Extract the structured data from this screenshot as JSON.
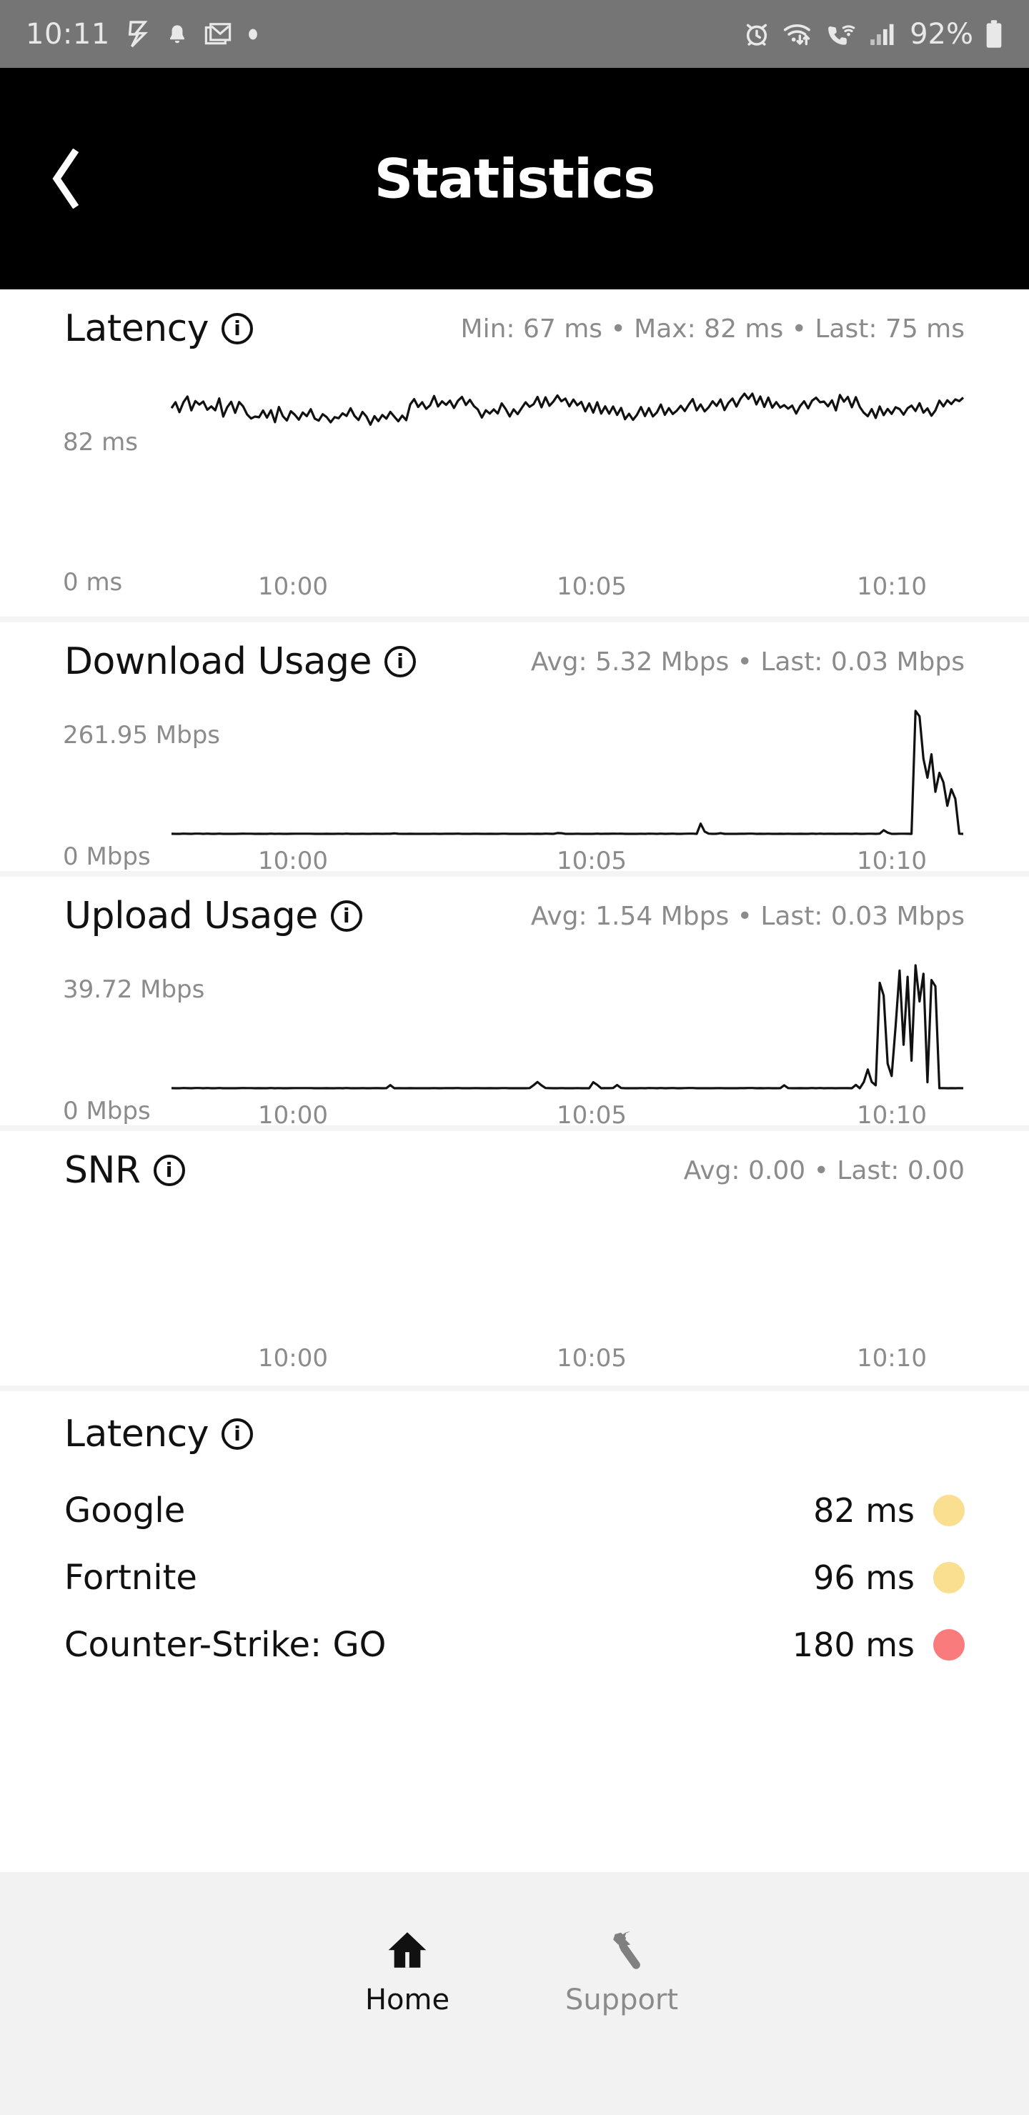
{
  "status_bar": {
    "time": "10:11",
    "battery_percent": "92%",
    "left_icons": [
      "nfc-icon",
      "bell-icon",
      "gmail-icon",
      "dot-icon"
    ],
    "right_icons": [
      "alarm-icon",
      "wifi-transfer-icon",
      "wifi-calling-icon",
      "signal-bars-icon",
      "battery-icon"
    ],
    "bg_color": "#757575",
    "fg_color": "#e8e8e8"
  },
  "header": {
    "title": "Statistics",
    "back_icon": "chevron-left-icon",
    "bg_color": "#000000",
    "fg_color": "#ffffff"
  },
  "sections": [
    {
      "key": "latency",
      "title": "Latency",
      "info_icon": "info-icon",
      "stats": "Min: 67 ms • Max: 82 ms • Last: 75 ms",
      "y_top": "82 ms",
      "y_bottom": "0 ms",
      "x_labels": [
        "10:00",
        "10:05",
        "10:10"
      ]
    },
    {
      "key": "download",
      "title": "Download Usage",
      "info_icon": "info-icon",
      "stats": "Avg: 5.32 Mbps • Last: 0.03 Mbps",
      "y_top": "261.95 Mbps",
      "y_bottom": "0 Mbps",
      "x_labels": [
        "10:00",
        "10:05",
        "10:10"
      ]
    },
    {
      "key": "upload",
      "title": "Upload Usage",
      "info_icon": "info-icon",
      "stats": "Avg: 1.54 Mbps • Last: 0.03 Mbps",
      "y_top": "39.72 Mbps",
      "y_bottom": "0 Mbps",
      "x_labels": [
        "10:00",
        "10:05",
        "10:10"
      ]
    },
    {
      "key": "snr",
      "title": "SNR",
      "info_icon": "info-icon",
      "stats": "Avg: 0.00 • Last: 0.00",
      "y_top": "",
      "y_bottom": "",
      "x_labels": [
        "10:00",
        "10:05",
        "10:10"
      ]
    }
  ],
  "latency_list": {
    "title": "Latency",
    "info_icon": "info-icon",
    "rows": [
      {
        "name": "Google",
        "value": "82 ms",
        "dot_color": "#fadf91"
      },
      {
        "name": "Fortnite",
        "value": "96 ms",
        "dot_color": "#fadf91"
      },
      {
        "name": "Counter-Strike: GO",
        "value": "180 ms",
        "dot_color": "#f97b7b"
      }
    ]
  },
  "bottom_nav": {
    "bg_color": "#f2f2f2",
    "items": [
      {
        "label": "Home",
        "icon": "home-icon",
        "active": true,
        "color": "#111111"
      },
      {
        "label": "Support",
        "icon": "wrench-icon",
        "active": false,
        "color": "#8b8b8b"
      }
    ]
  },
  "chart_data": [
    {
      "type": "line",
      "title": "Latency",
      "ylabel": "ms",
      "ylim": [
        0,
        82
      ],
      "yticks": [
        "0 ms",
        "82 ms"
      ],
      "x": [
        "10:00",
        "10:05",
        "10:10"
      ],
      "xlabel": "",
      "grid": false,
      "legend": "none",
      "stats": {
        "min": 67,
        "max": 82,
        "last": 75,
        "unit": "ms"
      },
      "values": [
        74,
        78,
        72,
        76,
        80,
        73,
        77,
        75,
        79,
        72,
        76,
        74,
        78,
        71,
        75,
        79,
        73,
        77,
        74,
        70,
        68,
        71,
        69,
        73,
        70,
        72,
        68,
        74,
        71,
        69,
        72,
        70,
        67,
        71,
        69,
        73,
        70,
        68,
        72,
        69,
        67,
        70,
        68,
        72,
        69,
        74,
        71,
        68,
        72,
        70,
        66,
        69,
        67,
        71,
        68,
        72,
        70,
        67,
        71,
        69,
        76,
        79,
        75,
        78,
        74,
        77,
        80,
        76,
        79,
        75,
        78,
        74,
        77,
        81,
        76,
        79,
        75,
        73,
        70,
        74,
        71,
        75,
        72,
        76,
        73,
        70,
        74,
        71,
        75,
        78,
        74,
        77,
        80,
        76,
        79,
        75,
        78,
        82,
        77,
        80,
        76,
        79,
        75,
        78,
        74,
        77,
        73,
        76,
        72,
        75,
        71,
        74,
        70,
        73,
        69,
        72,
        68,
        71,
        74,
        70,
        73,
        69,
        72,
        75,
        71,
        74,
        70,
        73,
        76,
        72,
        75,
        78,
        74,
        77,
        73,
        76,
        79,
        75,
        78,
        74,
        77,
        80,
        76,
        79,
        82,
        78,
        81,
        77,
        80,
        76,
        79,
        75,
        78,
        74,
        77,
        73,
        76,
        72,
        75,
        78,
        74,
        77,
        80,
        76,
        79,
        75,
        78,
        74,
        81,
        77,
        80,
        76,
        79,
        75,
        72,
        69,
        73,
        70,
        74,
        71,
        75,
        72,
        76,
        73,
        70,
        74,
        77,
        73,
        76,
        72,
        75,
        71,
        74,
        78,
        75,
        79,
        76,
        80,
        77,
        81
      ]
    },
    {
      "type": "line",
      "title": "Download Usage",
      "ylabel": "Mbps",
      "ylim": [
        0,
        261.95
      ],
      "yticks": [
        "0 Mbps",
        "261.95 Mbps"
      ],
      "x": [
        "10:00",
        "10:05",
        "10:10"
      ],
      "xlabel": "",
      "grid": false,
      "legend": "none",
      "stats": {
        "avg": 5.32,
        "last": 0.03,
        "unit": "Mbps"
      },
      "values": [
        0,
        0,
        0,
        0,
        0,
        0,
        0,
        0,
        0,
        0,
        0,
        0,
        0,
        0,
        0,
        0,
        0,
        0,
        0,
        0,
        0,
        0,
        0,
        0,
        0,
        0,
        0,
        0,
        0,
        0,
        0,
        0,
        0,
        0,
        0,
        0,
        0,
        0,
        0,
        0,
        0,
        0,
        0,
        0,
        0,
        0,
        0,
        0,
        0,
        0,
        0,
        0,
        0,
        0,
        0,
        0,
        1,
        0,
        0,
        0,
        0,
        0,
        0,
        0,
        0,
        0,
        0,
        0,
        0,
        0,
        0,
        0,
        0,
        0,
        0,
        0,
        0,
        0,
        0,
        0,
        0,
        0,
        0,
        0,
        0,
        0,
        0,
        0,
        0,
        0,
        0,
        0,
        0,
        0,
        0,
        0,
        0,
        2,
        1,
        0,
        0,
        0,
        0,
        0,
        0,
        0,
        0,
        0,
        0,
        0,
        0,
        0,
        0,
        0,
        0,
        0,
        0,
        0,
        0,
        0,
        0,
        0,
        0,
        0,
        0,
        0,
        0,
        0,
        0,
        0,
        0,
        0,
        0,
        22,
        5,
        1,
        0,
        0,
        1,
        0,
        0,
        0,
        0,
        0,
        0,
        0,
        0,
        0,
        0,
        0,
        0,
        0,
        0,
        0,
        0,
        0,
        0,
        0,
        0,
        0,
        0,
        0,
        0,
        0,
        0,
        0,
        0,
        0,
        0,
        0,
        0,
        0,
        0,
        0,
        0,
        0,
        0,
        0,
        0,
        8,
        3,
        0,
        0,
        0,
        0,
        0,
        0,
        262,
        250,
        160,
        120,
        170,
        90,
        130,
        110,
        60,
        95,
        75,
        0,
        0
      ]
    },
    {
      "type": "line",
      "title": "Upload Usage",
      "ylabel": "Mbps",
      "ylim": [
        0,
        39.72
      ],
      "yticks": [
        "0 Mbps",
        "39.72 Mbps"
      ],
      "x": [
        "10:00",
        "10:05",
        "10:10"
      ],
      "xlabel": "",
      "grid": false,
      "legend": "none",
      "stats": {
        "avg": 1.54,
        "last": 0.03,
        "unit": "Mbps"
      },
      "values": [
        0,
        0,
        0,
        0,
        0,
        0,
        0,
        0,
        0,
        0,
        0,
        0,
        0,
        0,
        0,
        0,
        0,
        0,
        0,
        0,
        0,
        0,
        0,
        0,
        0,
        0,
        0,
        0,
        0,
        0,
        0,
        0,
        0,
        0,
        0,
        0,
        0,
        0,
        0,
        0,
        0,
        0,
        0,
        0,
        0,
        0,
        0,
        0,
        0,
        0,
        0,
        0,
        0,
        0,
        0,
        1,
        0,
        0,
        0,
        0,
        0,
        0,
        0,
        0,
        0,
        0,
        0,
        0,
        0,
        0,
        0,
        0,
        0,
        0,
        0,
        0,
        0,
        0,
        0,
        0,
        0,
        0,
        0,
        0,
        0,
        0,
        0,
        0,
        0,
        0,
        0,
        1,
        2,
        1,
        0,
        0,
        0,
        0,
        0,
        0,
        0,
        0,
        0,
        0,
        0,
        0,
        2,
        1,
        0,
        0,
        0,
        0,
        1,
        0,
        0,
        0,
        0,
        0,
        0,
        0,
        0,
        0,
        0,
        0,
        0,
        0,
        0,
        0,
        0,
        0,
        0,
        0,
        0,
        0,
        0,
        0,
        0,
        0,
        0,
        0,
        0,
        0,
        0,
        0,
        0,
        0,
        0,
        0,
        0,
        0,
        0,
        0,
        0,
        0,
        1,
        0,
        0,
        0,
        0,
        0,
        0,
        0,
        0,
        0,
        0,
        0,
        0,
        0,
        0,
        0,
        0,
        0,
        1,
        0,
        2,
        6,
        2,
        1,
        34,
        30,
        8,
        4,
        20,
        38,
        14,
        36,
        9,
        40,
        28,
        37,
        2,
        35,
        33,
        0,
        0,
        0,
        0,
        0,
        0,
        0
      ]
    },
    {
      "type": "line",
      "title": "SNR",
      "ylabel": "",
      "ylim": [
        0,
        0
      ],
      "yticks": [],
      "x": [
        "10:00",
        "10:05",
        "10:10"
      ],
      "xlabel": "",
      "grid": false,
      "legend": "none",
      "stats": {
        "avg": 0.0,
        "last": 0.0
      },
      "values": []
    }
  ]
}
